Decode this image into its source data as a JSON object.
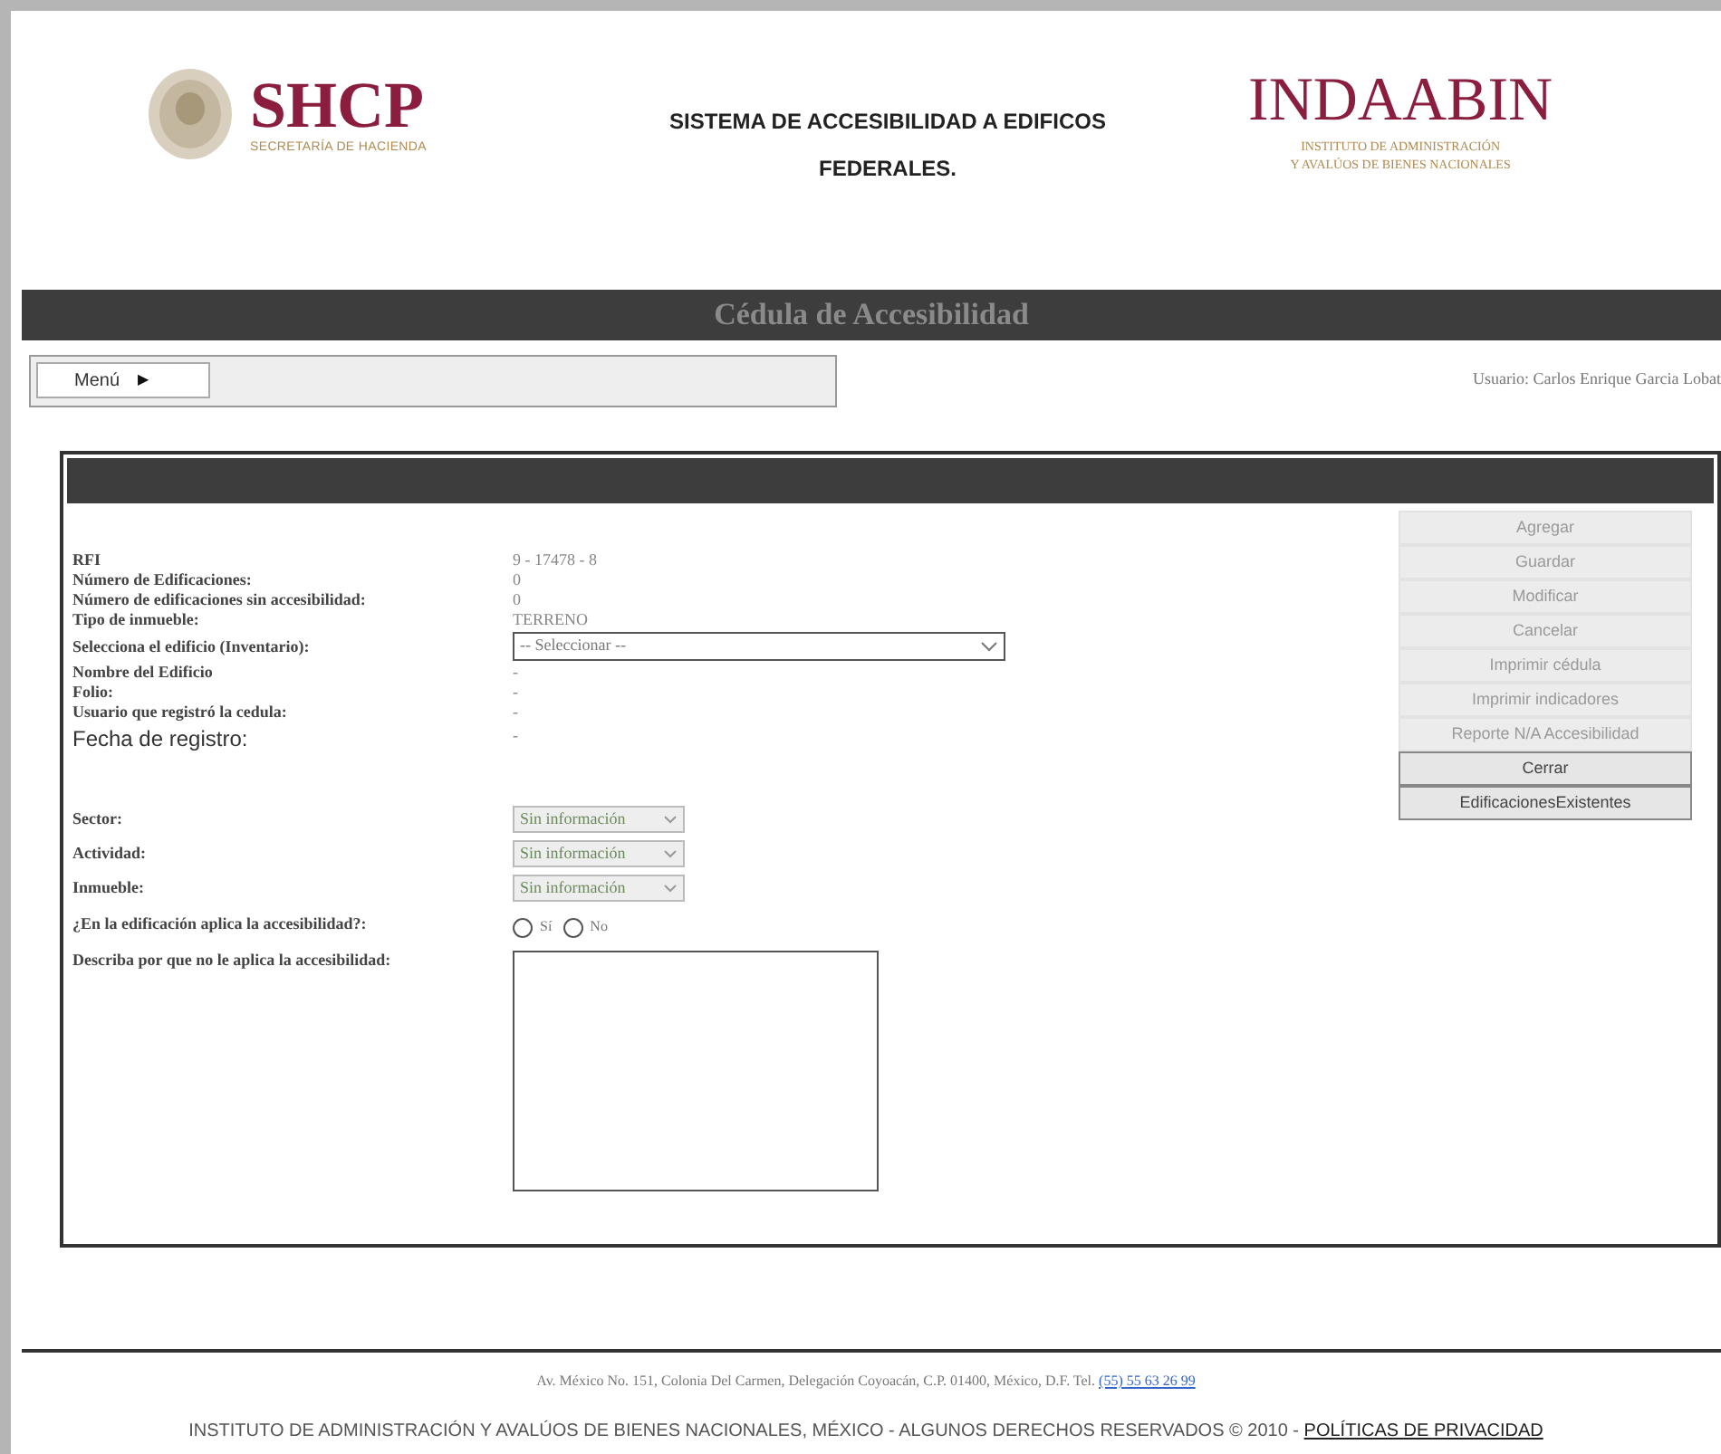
{
  "header": {
    "shcp": {
      "name": "SHCP",
      "subtitle": "SECRETARÍA DE HACIENDA"
    },
    "title_lines": [
      "SISTEMA DE ACCESIBILIDAD A EDIFICOS",
      "FEDERALES."
    ],
    "indaabin": {
      "name": "INDAABIN",
      "subtitle_lines": [
        "INSTITUTO DE ADMINISTRACIÓN",
        "Y AVALÚOS DE BIENES NACIONALES"
      ]
    }
  },
  "title_bar": "Cédula de Accesibilidad",
  "menu": {
    "label": "Menú",
    "arrow": "▶"
  },
  "user": "Usuario: Carlos Enrique Garcia Lobat",
  "fields": [
    {
      "kind": "text",
      "label": "RFI",
      "value": "9 - 17478 - 8"
    },
    {
      "kind": "text",
      "label": "Número de Edificaciones:",
      "value": "0"
    },
    {
      "kind": "text",
      "label": "Número de edificaciones sin accesibilidad:",
      "value": "0"
    },
    {
      "kind": "text",
      "label": "Tipo de inmueble:",
      "value": "TERRENO"
    },
    {
      "kind": "select",
      "label": "Selecciona el edificio (Inventario):",
      "value": "-- Seleccionar --"
    },
    {
      "kind": "text",
      "label": "Nombre del Edificio",
      "value": "-"
    },
    {
      "kind": "text",
      "label": "Folio:",
      "value": "-"
    },
    {
      "kind": "text",
      "label": "Usuario que registró la cedula:",
      "value": "-"
    },
    {
      "kind": "big",
      "label": "Fecha de registro:",
      "value": "-"
    },
    {
      "kind": "gap"
    },
    {
      "kind": "small_select",
      "label": "Sector:",
      "value": "Sin información"
    },
    {
      "kind": "small_select",
      "label": "Actividad:",
      "value": "Sin información"
    },
    {
      "kind": "small_select",
      "label": "Inmueble:",
      "value": "Sin información"
    },
    {
      "kind": "radio",
      "label": "¿En la edificación aplica la accesibilidad?:",
      "options": [
        {
          "label": "Sí",
          "selected": false
        },
        {
          "label": "No",
          "selected": false
        }
      ]
    },
    {
      "kind": "textarea",
      "label": "Describa por que no le aplica la accesibilidad:"
    }
  ],
  "buttons": [
    {
      "label": "Agregar",
      "disabled": true
    },
    {
      "label": "Guardar",
      "disabled": true
    },
    {
      "label": "Modificar",
      "disabled": true
    },
    {
      "label": "Cancelar",
      "disabled": true
    },
    {
      "label": "Imprimir cédula",
      "disabled": true
    },
    {
      "label": "Imprimir indicadores",
      "disabled": true
    },
    {
      "label": "Reporte N/A Accesibilidad",
      "disabled": true
    },
    {
      "label": "Cerrar",
      "disabled": false
    },
    {
      "label": "EdificacionesExistentes",
      "disabled": false
    }
  ],
  "footer": {
    "address": "Av. México No. 151, Colonia Del Carmen, Delegación Coyoacán, C.P. 01400, México, D.F. Tel.",
    "phone": "(55) 55 63 26 99",
    "copyright": "INSTITUTO DE ADMINISTRACIÓN Y AVALÚOS DE BIENES NACIONALES, MÉXICO - ALGUNOS DERECHOS RESERVADOS © 2010 -",
    "privacy": "POLÍTICAS DE PRIVACIDAD"
  }
}
